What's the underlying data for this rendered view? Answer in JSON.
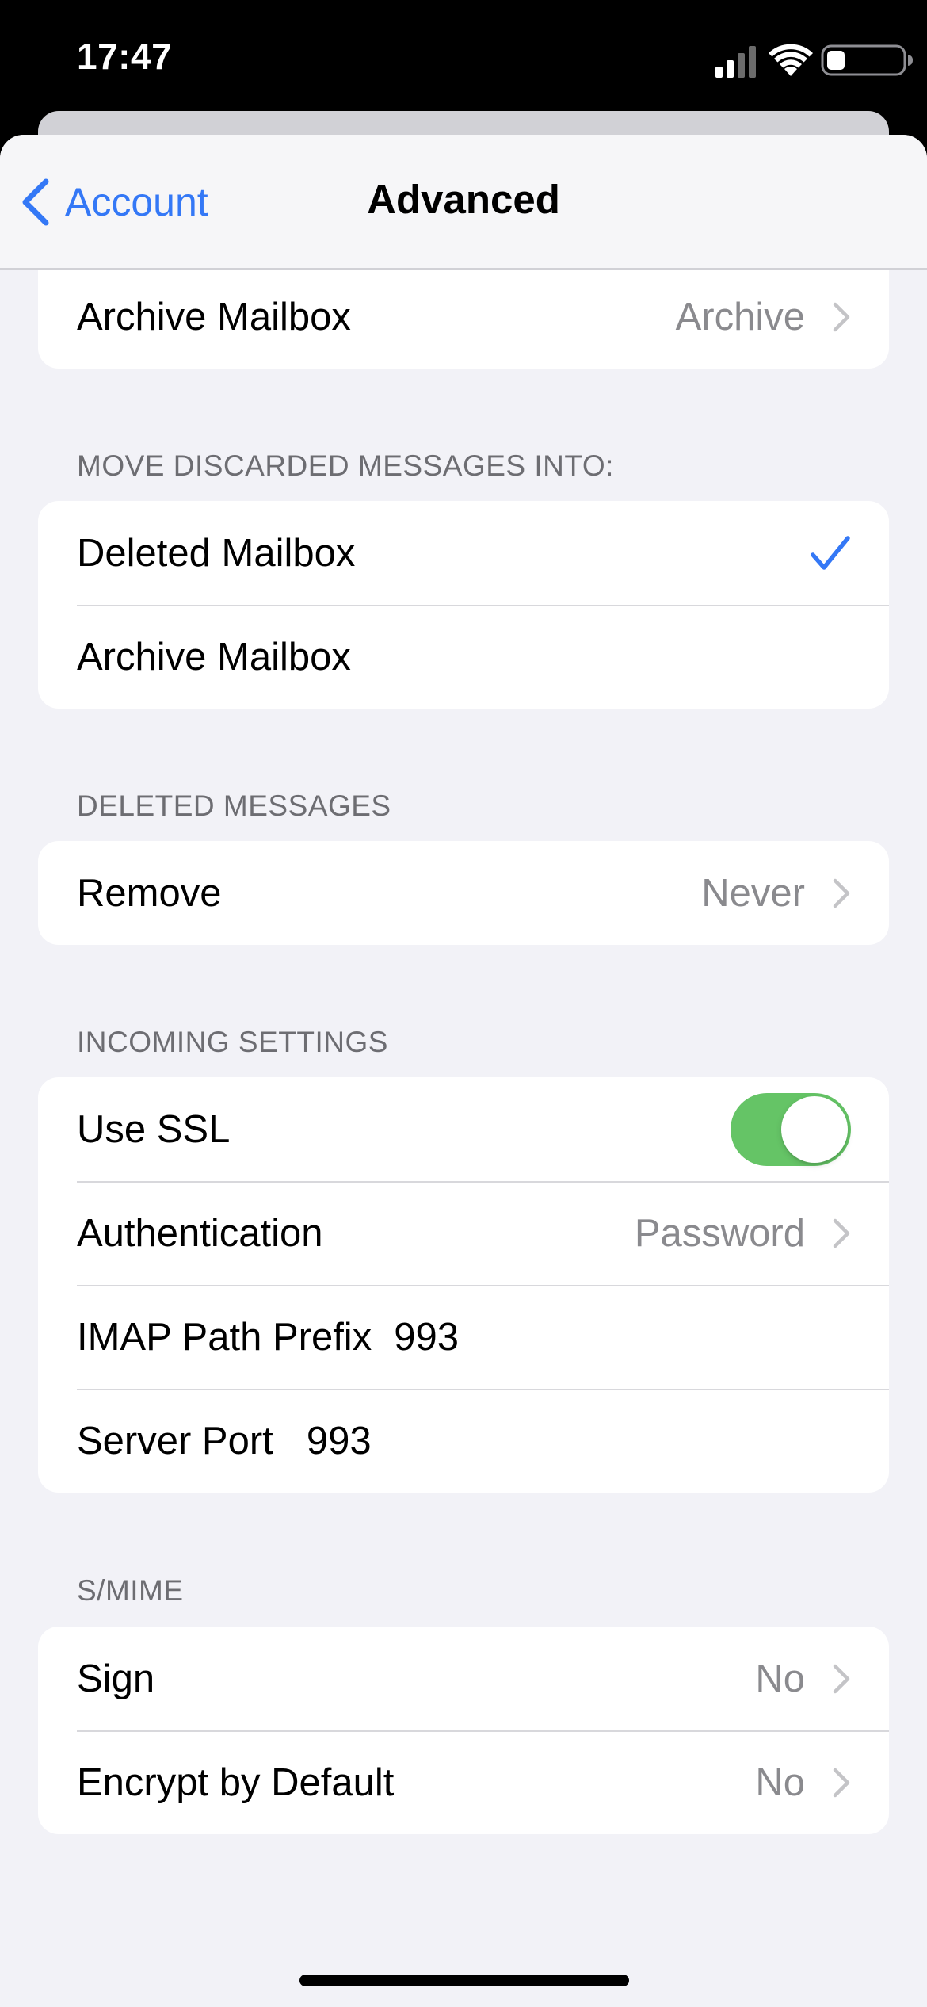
{
  "status_bar": {
    "time": "17:47",
    "icons": [
      "signal-icon",
      "wifi-icon",
      "battery-icon"
    ]
  },
  "nav": {
    "back_label": "Account",
    "title": "Advanced"
  },
  "top_group": {
    "row_label": "Archive Mailbox",
    "row_value": "Archive"
  },
  "discarded": {
    "header": "MOVE DISCARDED MESSAGES INTO:",
    "options": [
      {
        "label": "Deleted Mailbox",
        "selected": true
      },
      {
        "label": "Archive Mailbox",
        "selected": false
      }
    ]
  },
  "deleted_messages": {
    "header": "DELETED MESSAGES",
    "remove_label": "Remove",
    "remove_value": "Never"
  },
  "incoming": {
    "header": "INCOMING SETTINGS",
    "use_ssl_label": "Use SSL",
    "use_ssl_on": true,
    "auth_label": "Authentication",
    "auth_value": "Password",
    "imap_label": "IMAP Path Prefix",
    "imap_value": "993",
    "port_label": "Server Port",
    "port_value": "993"
  },
  "smime": {
    "header": "S/MIME",
    "sign_label": "Sign",
    "sign_value": "No",
    "encrypt_label": "Encrypt by Default",
    "encrypt_value": "No"
  },
  "colors": {
    "accent": "#3478f6",
    "toggle_on": "#65c466",
    "background": "#f2f2f7",
    "secondary_text": "#8a8a8e"
  }
}
